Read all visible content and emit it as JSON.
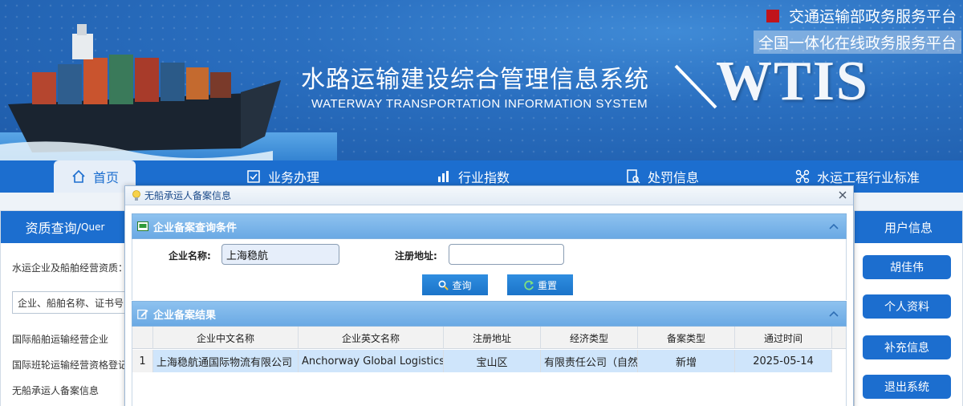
{
  "portal": {
    "line1": "交通运输部政务服务平台",
    "line2": "全国一体化在线政务服务平台"
  },
  "system": {
    "title_cn": "水路运输建设综合管理信息系统",
    "title_en": "WATERWAY TRANSPORTATION INFORMATION SYSTEM",
    "logo": "WTIS"
  },
  "nav": {
    "items": [
      {
        "label": "首页",
        "icon": "home-icon"
      },
      {
        "label": "业务办理",
        "icon": "checklist-icon"
      },
      {
        "label": "行业指数",
        "icon": "bar-chart-icon"
      },
      {
        "label": "处罚信息",
        "icon": "document-search-icon"
      },
      {
        "label": "水运工程行业标准",
        "icon": "network-icon"
      }
    ]
  },
  "left_panel": {
    "title": "资质查询/",
    "title_en": "Quer",
    "qual_label": "水运企业及船舶经营资质：",
    "select_value": "企业、船舶名称、证书号",
    "links": [
      "国际船舶运输经营企业",
      "国际班轮运输经营资格登记",
      "无船承运人备案信息"
    ]
  },
  "right_panel": {
    "title": "用户信息",
    "buttons": [
      "胡佳伟",
      "个人资料",
      "补充信息",
      "退出系统"
    ]
  },
  "dialog": {
    "title": "无船承运人备案信息",
    "query_section": "企业备案查询条件",
    "name_label": "企业名称:",
    "name_value": "上海稳航",
    "address_label": "注册地址:",
    "address_value": "",
    "search_button": "查询",
    "reset_button": "重置",
    "result_section": "企业备案结果",
    "columns": [
      "企业中文名称",
      "企业英文名称",
      "注册地址",
      "经济类型",
      "备案类型",
      "通过时间"
    ],
    "rows": [
      [
        "1",
        "上海稳航通国际物流有限公司",
        "Anchorway Global Logistics",
        "宝山区",
        "有限责任公司（自然人",
        "新增",
        "2025-05-14"
      ]
    ]
  }
}
